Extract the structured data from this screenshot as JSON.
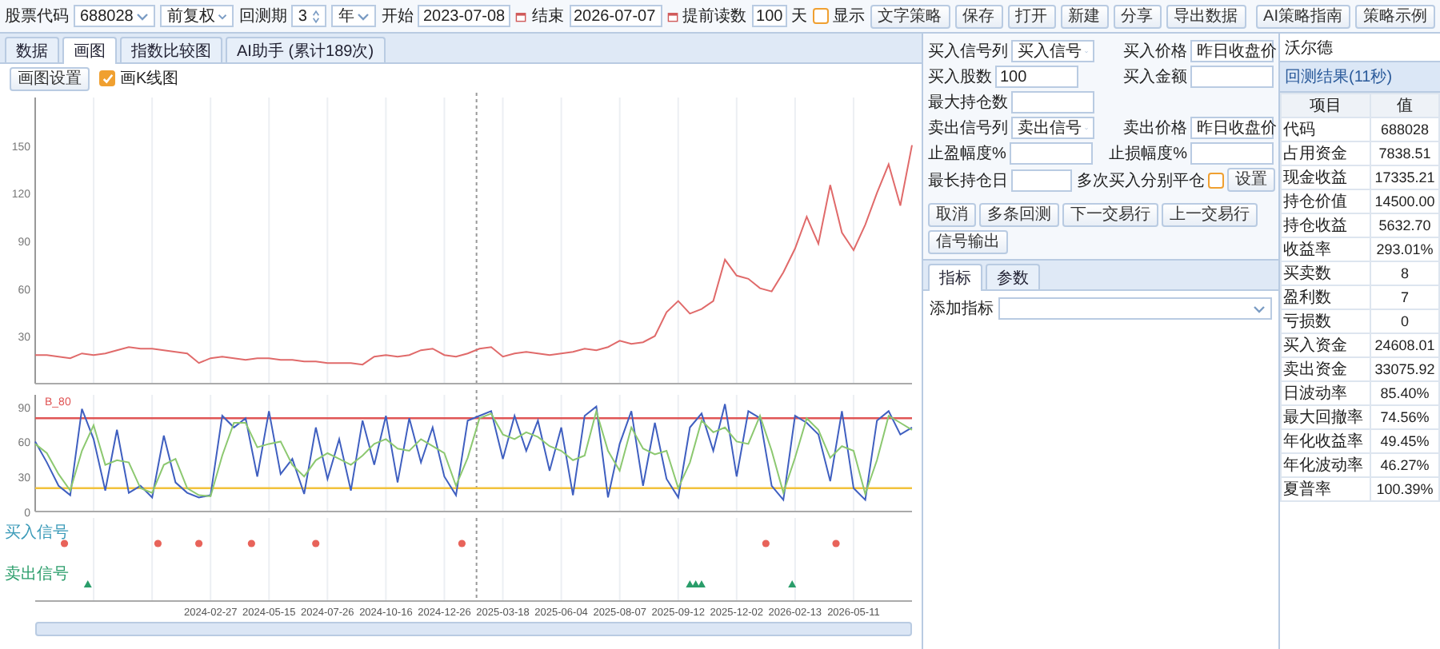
{
  "toolbar": {
    "stock_code_label": "股票代码",
    "stock_code": "688028",
    "adjust": "前复权",
    "period_label": "回测期",
    "period": "3",
    "period_unit": "年",
    "start_label": "开始",
    "start": "2023-07-08",
    "end_label": "结束",
    "end": "2026-07-07",
    "preload_label": "提前读数",
    "preload": "100",
    "preload_unit": "天",
    "show": {
      "label": "显示",
      "checked": false
    },
    "buttons": [
      "文字策略",
      "保存",
      "打开",
      "新建",
      "分享",
      "导出数据"
    ],
    "right_buttons": [
      "AI策略指南",
      "策略示例"
    ]
  },
  "tabs": [
    {
      "label": "数据",
      "selected": false
    },
    {
      "label": "画图",
      "selected": true
    },
    {
      "label": "指数比较图",
      "selected": false
    },
    {
      "label": "AI助手 (累计189次)",
      "selected": false
    }
  ],
  "chart_toolbar": {
    "button": "画图设置",
    "kline": {
      "label": "画K线图",
      "checked": true
    }
  },
  "price_chart": {
    "chart_data": {
      "type": "line",
      "ylim": [
        0,
        180
      ],
      "yticks": [
        30,
        60,
        90,
        120,
        150
      ],
      "grid": true,
      "series": [
        {
          "color": "#e06a6a",
          "values": [
            18,
            18,
            17,
            16,
            19,
            18,
            19,
            21,
            23,
            22,
            22,
            21,
            20,
            19,
            13,
            16,
            17,
            16,
            15,
            16,
            16,
            15,
            15,
            14,
            14,
            13,
            13,
            13,
            12,
            17,
            18,
            17,
            18,
            21,
            22,
            18,
            17,
            19,
            22,
            23,
            17,
            19,
            20,
            19,
            18,
            19,
            20,
            22,
            21,
            23,
            27,
            25,
            26,
            30,
            45,
            52,
            44,
            47,
            52,
            78,
            68,
            66,
            60,
            58,
            70,
            85,
            105,
            88,
            125,
            95,
            84,
            100,
            120,
            138,
            112,
            150
          ]
        }
      ]
    }
  },
  "indicator_chart": {
    "chart_data": {
      "type": "line",
      "ylim": [
        0,
        100
      ],
      "yticks": [
        0,
        30,
        60,
        90
      ],
      "grid": true,
      "series": [
        {
          "color": "#3f5fc0",
          "values": [
            60,
            42,
            22,
            14,
            88,
            62,
            18,
            70,
            16,
            22,
            12,
            65,
            25,
            16,
            12,
            14,
            82,
            72,
            80,
            30,
            86,
            32,
            45,
            15,
            72,
            28,
            62,
            18,
            78,
            40,
            82,
            25,
            80,
            42,
            72,
            30,
            14,
            78,
            82,
            86,
            45,
            82,
            52,
            78,
            35,
            72,
            14,
            82,
            90,
            12,
            58,
            86,
            22,
            76,
            28,
            12,
            72,
            84,
            52,
            92,
            30,
            86,
            80,
            22,
            10,
            82,
            76,
            66,
            26,
            86,
            20,
            10,
            78,
            86,
            66,
            72
          ]
        },
        {
          "color": "#8cc870",
          "values": [
            58,
            50,
            32,
            18,
            52,
            74,
            40,
            44,
            42,
            20,
            16,
            40,
            45,
            20,
            14,
            13,
            48,
            76,
            76,
            55,
            58,
            60,
            40,
            30,
            44,
            50,
            45,
            40,
            48,
            58,
            62,
            54,
            52,
            62,
            56,
            50,
            22,
            46,
            80,
            84,
            66,
            62,
            68,
            64,
            56,
            52,
            44,
            48,
            86,
            52,
            35,
            72,
            54,
            49,
            52,
            20,
            42,
            78,
            68,
            72,
            60,
            58,
            82,
            52,
            16,
            46,
            80,
            70,
            46,
            56,
            52,
            15,
            44,
            82,
            76,
            70
          ]
        }
      ],
      "ref_lines": [
        {
          "axis": "y",
          "value": 80,
          "color": "#e05555",
          "label": "B_80"
        },
        {
          "axis": "y",
          "value": 20,
          "color": "#f2c23c"
        }
      ]
    }
  },
  "signal_panel": {
    "rows": [
      {
        "label": "买入信号",
        "kind": "dot",
        "color": "#e8635a"
      },
      {
        "label": "卖出信号",
        "kind": "triangle",
        "color": "#2a9d6a"
      }
    ],
    "dates": [
      "2024-02-27",
      "2024-05-15",
      "2024-07-26",
      "2024-10-16",
      "2024-12-26",
      "2025-03-18",
      "2025-06-04",
      "2025-08-07",
      "2025-09-12",
      "2025-12-02",
      "2026-02-13",
      "2026-05-11"
    ]
  },
  "form": {
    "rows": [
      [
        {
          "label": "买入信号列",
          "kind": "select",
          "value": "买入信号"
        },
        {
          "label": "买入价格",
          "kind": "select",
          "value": "昨日收盘价"
        }
      ],
      [
        {
          "label": "买入股数",
          "kind": "input",
          "value": "100"
        },
        {
          "label": "买入金额",
          "kind": "input"
        }
      ],
      [
        {
          "label": "最大持仓数",
          "kind": "input"
        }
      ],
      [
        {
          "label": "卖出信号列",
          "kind": "select",
          "value": "卖出信号"
        },
        {
          "label": "卖出价格",
          "kind": "select",
          "value": "昨日收盘价"
        }
      ],
      [
        {
          "label": "止盈幅度%",
          "kind": "input"
        },
        {
          "label": "止损幅度%",
          "kind": "input"
        }
      ],
      [
        {
          "label": "最长持仓日",
          "kind": "input"
        },
        {
          "label": "多次买入分别平仓",
          "kind": "checkbox",
          "checked": false,
          "button": "设置"
        }
      ]
    ],
    "actions": [
      "取消",
      "多条回测",
      "下一交易行",
      "上一交易行",
      "信号输出"
    ]
  },
  "indicator_tabs": [
    {
      "label": "指标",
      "selected": true
    },
    {
      "label": "参数",
      "selected": false
    }
  ],
  "add_indicator": {
    "label": "添加指标"
  },
  "results": {
    "strategy_name": "沃尔德",
    "title": "回测结果(11秒)",
    "columns": [
      "项目",
      "值"
    ],
    "rows": [
      [
        "代码",
        "688028"
      ],
      [
        "占用资金",
        "7838.51"
      ],
      [
        "现金收益",
        "17335.21"
      ],
      [
        "持仓价值",
        "14500.00"
      ],
      [
        "持仓收益",
        "5632.70"
      ],
      [
        "收益率",
        "293.01%"
      ],
      [
        "买卖数",
        "8"
      ],
      [
        "盈利数",
        "7"
      ],
      [
        "亏损数",
        "0"
      ],
      [
        "买入资金",
        "24608.01"
      ],
      [
        "卖出资金",
        "33075.92"
      ],
      [
        "日波动率",
        "85.40%"
      ],
      [
        "最大回撤率",
        "74.56%"
      ],
      [
        "年化收益率",
        "49.45%"
      ],
      [
        "年化波动率",
        "46.27%"
      ],
      [
        "夏普率",
        "100.39%"
      ]
    ]
  }
}
